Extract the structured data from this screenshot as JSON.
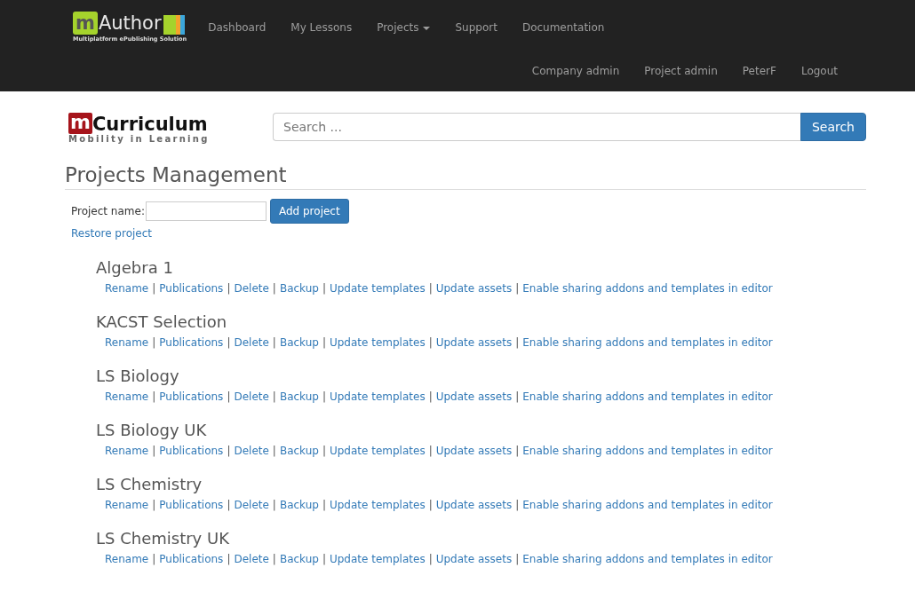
{
  "navbar": {
    "logo": {
      "mark": "m",
      "name": "Author",
      "tagline": "Multiplatform ePublishing Solution"
    },
    "items": [
      {
        "label": "Dashboard",
        "dropdown": false
      },
      {
        "label": "My Lessons",
        "dropdown": false
      },
      {
        "label": "Projects",
        "dropdown": true
      },
      {
        "label": "Support",
        "dropdown": false
      },
      {
        "label": "Documentation",
        "dropdown": false
      }
    ],
    "user_items": [
      "Company admin",
      "Project admin",
      "PeterF",
      "Logout"
    ]
  },
  "brand": {
    "mark": "m",
    "name": "Curriculum",
    "tagline": "Mobility in Learning"
  },
  "search": {
    "placeholder": "Search ...",
    "button": "Search"
  },
  "page_title": "Projects Management",
  "add_form": {
    "label": "Project name:",
    "button": "Add project",
    "restore_link": "Restore project"
  },
  "projects": [
    {
      "name": "Algebra 1",
      "separator": "|",
      "actions": [
        "Rename",
        "Publications",
        "Delete",
        "Backup",
        "Update templates",
        "Update assets",
        "Enable sharing addons and templates in editor"
      ]
    },
    {
      "name": "KACST Selection",
      "separator": "|",
      "actions": [
        "Rename",
        "Publications",
        "Delete",
        "Backup",
        "Update templates",
        "Update assets",
        "Enable sharing addons and templates in editor"
      ]
    },
    {
      "name": "LS Biology",
      "separator": "|",
      "actions": [
        "Rename",
        "Publications",
        "Delete",
        "Backup",
        "Update templates",
        "Update assets",
        "Enable sharing addons and templates in editor"
      ]
    },
    {
      "name": "LS Biology UK",
      "separator": "|",
      "actions": [
        "Rename",
        "Publications",
        "Delete",
        "Backup",
        "Update templates",
        "Update assets",
        "Enable sharing addons and templates in editor"
      ]
    },
    {
      "name": "LS Chemistry",
      "separator": "|",
      "actions": [
        "Rename",
        "Publications",
        "Delete",
        "Backup",
        "Update templates",
        "Update assets",
        "Enable sharing addons and templates in editor"
      ]
    },
    {
      "name": "LS Chemistry UK",
      "separator": "|",
      "actions": [
        "Rename",
        "Publications",
        "Delete",
        "Backup",
        "Update templates",
        "Update assets",
        "Enable sharing addons and templates in editor"
      ]
    }
  ]
}
